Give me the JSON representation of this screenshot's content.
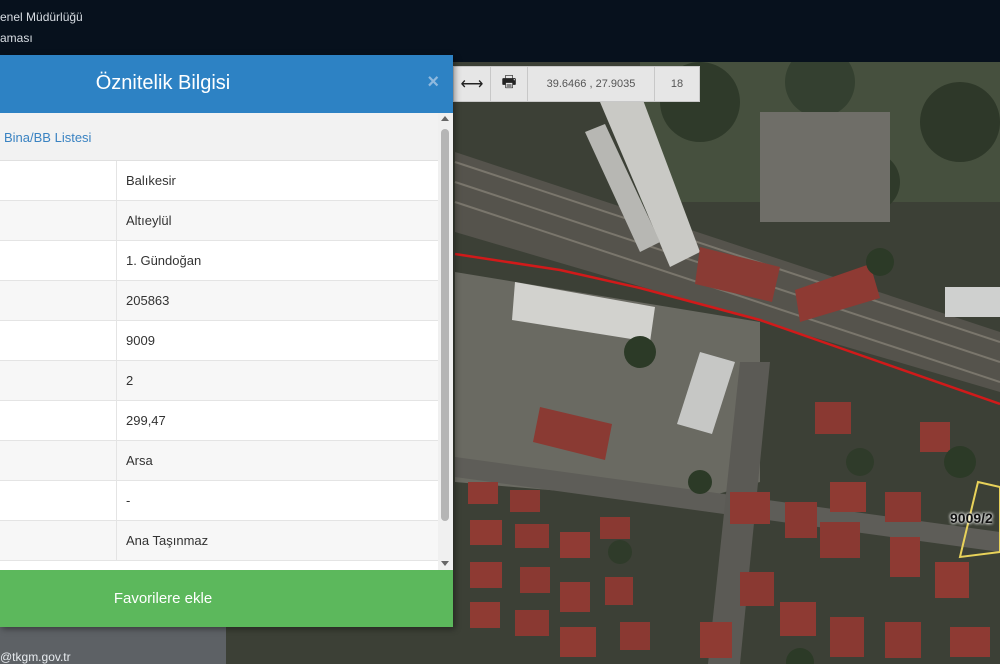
{
  "topbar": {
    "line1": "enel Müdürlüğü",
    "line2": "aması"
  },
  "toolbar": {
    "items": [
      {
        "icon": "pan-horizontal-icon",
        "glyph": "⟷"
      },
      {
        "icon": "printer-icon",
        "glyph": "🖶"
      }
    ],
    "coords": "39.6466 , 27.9035",
    "zoom": "18"
  },
  "map": {
    "parcel_label": "9009/2"
  },
  "panel": {
    "title": "Öznitelik Bilgisi",
    "close_glyph": "×",
    "list_header": "Bina/BB Listesi",
    "rows": [
      {
        "value": "Balıkesir"
      },
      {
        "value": "Altıeylül"
      },
      {
        "value": "1. Gündoğan"
      },
      {
        "value": "205863"
      },
      {
        "value": "9009"
      },
      {
        "value": "2"
      },
      {
        "value": "299,47"
      },
      {
        "value": "Arsa"
      },
      {
        "value": "-"
      },
      {
        "value": "Ana Taşınmaz"
      }
    ],
    "footer_button": "Favorilere ekle"
  },
  "sidebar": {
    "email_fragment": "@tkgm.gov.tr"
  },
  "colors": {
    "header_blue": "#2d82c4",
    "footer_green": "#5cb85c",
    "link_blue": "#3a83c2",
    "railway_red": "#d11a1a",
    "parcel_yellow": "#e8d25a"
  }
}
